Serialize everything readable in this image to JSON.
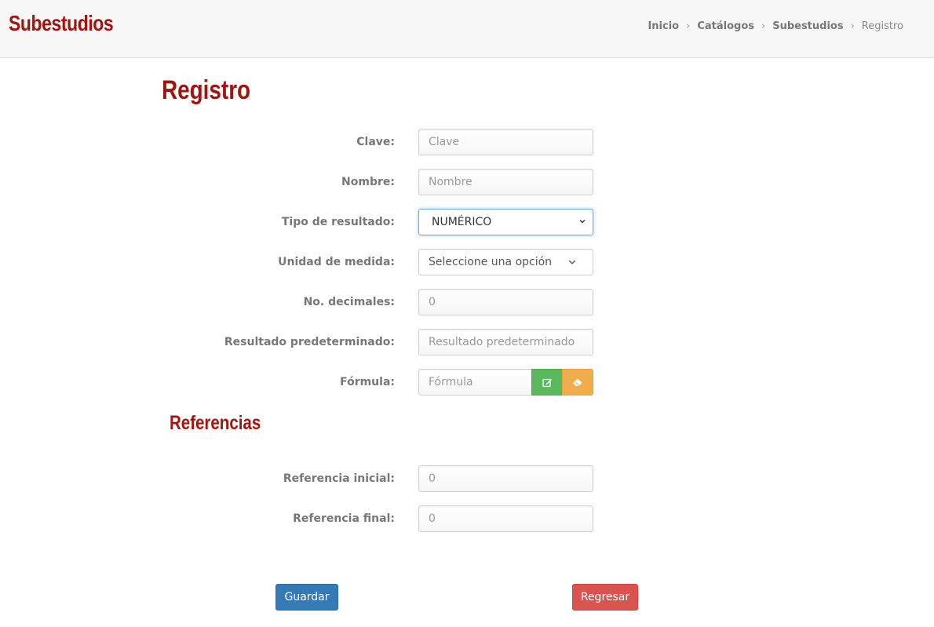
{
  "header": {
    "app_title": "Subestudios",
    "breadcrumb": [
      "Inicio",
      "Catálogos",
      "Subestudios",
      "Registro"
    ]
  },
  "page_title": "Registro",
  "form": {
    "clave": {
      "label": "Clave:",
      "placeholder": "Clave",
      "value": ""
    },
    "nombre": {
      "label": "Nombre:",
      "placeholder": "Nombre",
      "value": ""
    },
    "tipo_resultado": {
      "label": "Tipo de resultado:",
      "value": "NUMÉRICO"
    },
    "unidad_medida": {
      "label": "Unidad de medida:",
      "value": "Seleccione una opción"
    },
    "decimales": {
      "label": "No. decimales:",
      "value": "0"
    },
    "resultado_predeterminado": {
      "label": "Resultado predeterminado:",
      "placeholder": "Resultado predeterminado",
      "value": ""
    },
    "formula": {
      "label": "Fórmula:",
      "placeholder": "Fórmula",
      "value": "",
      "edit_icon": "edit-icon",
      "clear_icon": "eraser-icon"
    }
  },
  "referencias": {
    "title": "Referencias",
    "inicial": {
      "label": "Referencia inicial:",
      "value": "0"
    },
    "final": {
      "label": "Referencia final:",
      "value": "0"
    }
  },
  "actions": {
    "save_label": "Guardar",
    "back_label": "Regresar"
  },
  "colors": {
    "brand": "#a3140e",
    "save": "#337ab7",
    "back": "#d9534f",
    "edit": "#5cb85c",
    "clear": "#f0ad4e"
  }
}
